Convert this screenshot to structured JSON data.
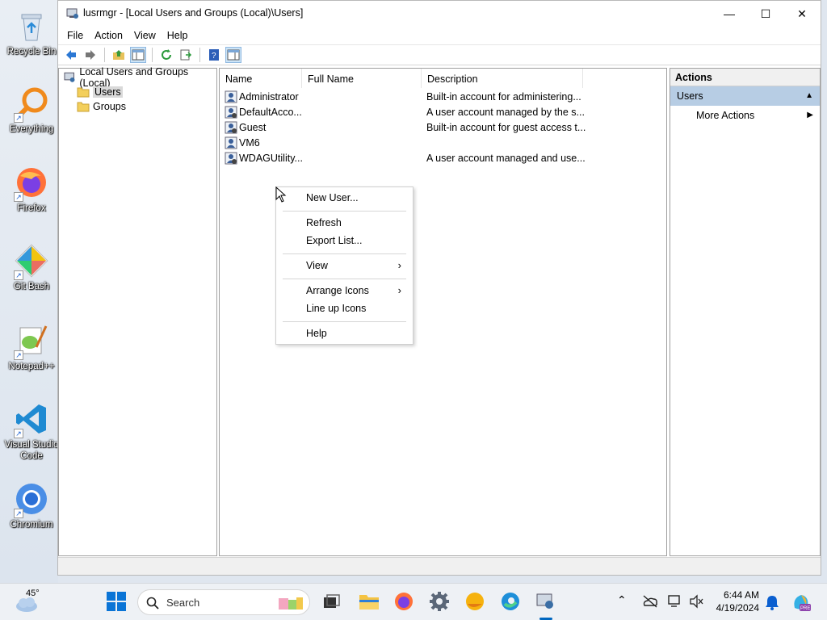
{
  "desktop": {
    "icons": [
      {
        "name": "recycle-bin",
        "label": "Recycle Bin"
      },
      {
        "name": "everything",
        "label": "Everything"
      },
      {
        "name": "firefox",
        "label": "Firefox"
      },
      {
        "name": "git-bash",
        "label": "Git Bash"
      },
      {
        "name": "notepadpp",
        "label": "Notepad++"
      },
      {
        "name": "vscode",
        "label": "Visual Studio Code"
      },
      {
        "name": "chromium",
        "label": "Chromium"
      }
    ]
  },
  "window": {
    "title": "lusrmgr - [Local Users and Groups (Local)\\Users]",
    "controls": {
      "minimize": "—",
      "maximize": "☐",
      "close": "✕"
    }
  },
  "menubar": [
    "File",
    "Action",
    "View",
    "Help"
  ],
  "tree": {
    "root": "Local Users and Groups (Local)",
    "children": [
      "Users",
      "Groups"
    ]
  },
  "listview": {
    "columns": [
      "Name",
      "Full Name",
      "Description"
    ],
    "rows": [
      {
        "name": "Administrator",
        "full": "",
        "desc": "Built-in account for administering..."
      },
      {
        "name": "DefaultAcco...",
        "full": "",
        "desc": "A user account managed by the s..."
      },
      {
        "name": "Guest",
        "full": "",
        "desc": "Built-in account for guest access t..."
      },
      {
        "name": "VM6",
        "full": "",
        "desc": ""
      },
      {
        "name": "WDAGUtility...",
        "full": "",
        "desc": "A user account managed and use..."
      }
    ]
  },
  "actions": {
    "header": "Actions",
    "section": "Users",
    "items": [
      "More Actions"
    ]
  },
  "context_menu": {
    "items": [
      "New User...",
      "Refresh",
      "Export List...",
      "View",
      "Arrange Icons",
      "Line up Icons",
      "Help"
    ]
  },
  "taskbar": {
    "weather_temp": "45°",
    "search_placeholder": "Search",
    "time": "6:44 AM",
    "date": "4/19/2024"
  },
  "colors": {
    "accent": "#0067c0",
    "selection": "#cce4f7",
    "actions_section": "#b7cde4"
  }
}
